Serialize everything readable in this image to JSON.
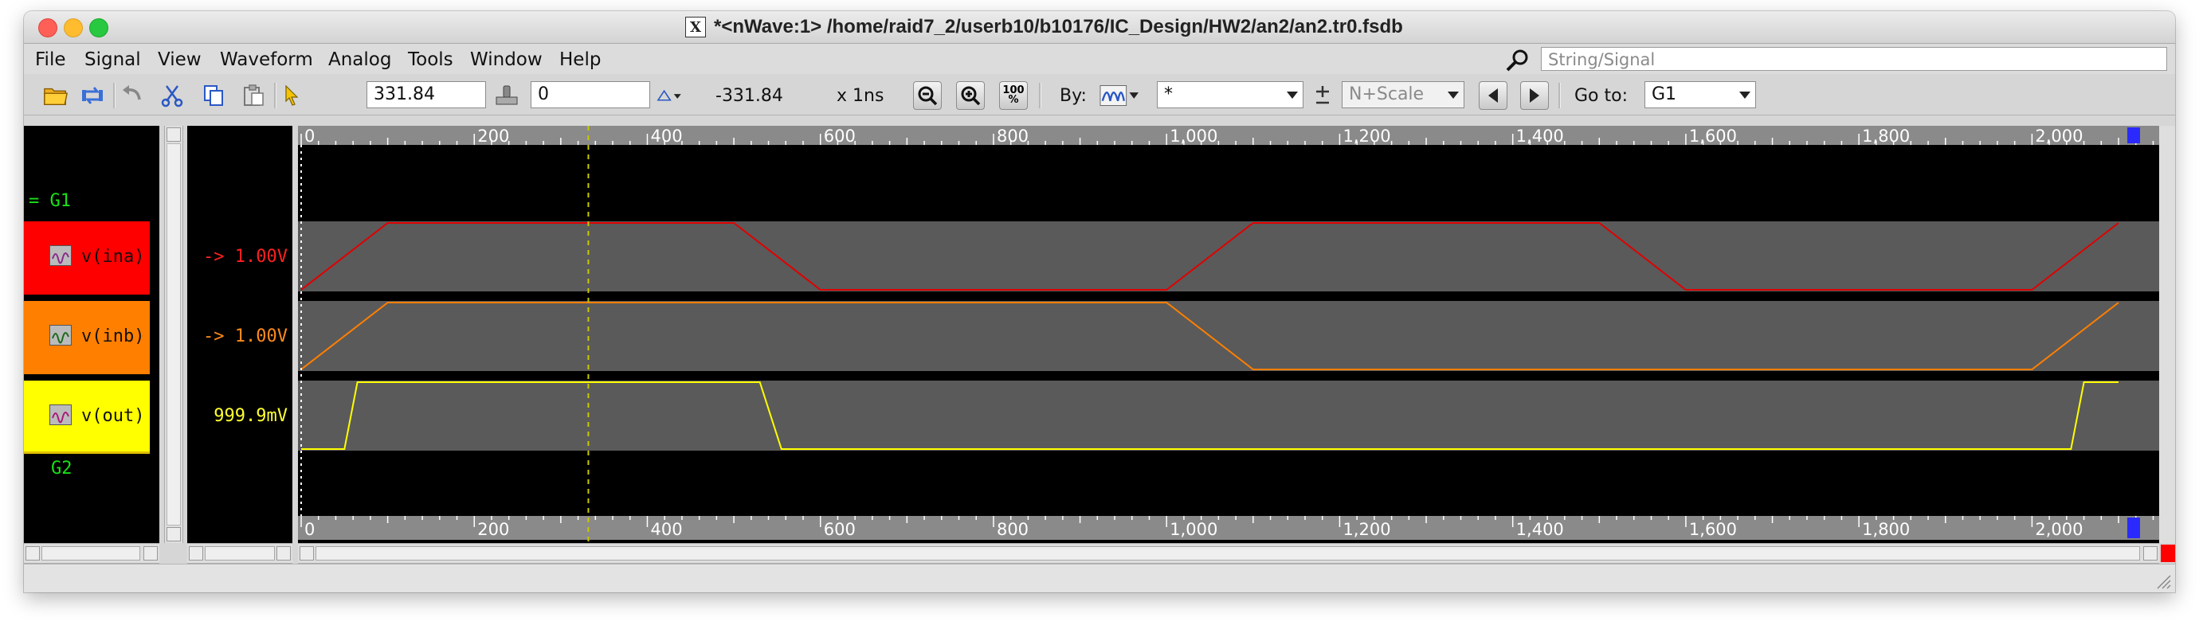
{
  "window": {
    "title": "*<nWave:1> /home/raid7_2/userb10/b10176/IC_Design/HW2/an2/an2.tr0.fsdb"
  },
  "menu": [
    {
      "label": "File"
    },
    {
      "label": "Signal"
    },
    {
      "label": "View"
    },
    {
      "label": "Waveform"
    },
    {
      "label": "Analog"
    },
    {
      "label": "Tools"
    },
    {
      "label": "Window"
    },
    {
      "label": "Help"
    }
  ],
  "search": {
    "placeholder": "String/Signal"
  },
  "toolbar": {
    "cursor_time": "331.84",
    "marker_time": "0",
    "delta": "-331.84",
    "unit": "x 1ns",
    "zoom_100": "100\n%",
    "by_label": "By:",
    "by_value": "*",
    "scale_value": "N+Scale",
    "goto_label": "Go to:",
    "goto_value": "G1"
  },
  "groups": [
    {
      "label": "= G1"
    },
    {
      "label": "G2"
    }
  ],
  "signals": [
    {
      "name": "v(ina)",
      "value": "-> 1.00V",
      "color": "#e00000",
      "name_bg": "#ff0000"
    },
    {
      "name": "v(inb)",
      "value": "-> 1.00V",
      "color": "#ff7f00",
      "name_bg": "#ff7f00"
    },
    {
      "name": "v(out)",
      "value": "999.9mV",
      "color": "#ffff00",
      "name_bg": "#ffff00"
    }
  ],
  "timeline": {
    "top_ticks": [
      "0",
      "200",
      "400",
      "600",
      "800",
      "1,000",
      "1,200",
      "1,400",
      "1,600",
      "1,800",
      "2,000"
    ],
    "bottom_ticks": [
      "0",
      "200",
      "400",
      "600",
      "800",
      "1,000",
      "1,200",
      "1,400",
      "1,600",
      "1,800",
      "2,000"
    ],
    "cursor_time_ns": 331.84,
    "marker_time_ns": 0
  },
  "waveforms": {
    "ina_ns": [
      [
        0,
        0
      ],
      [
        100,
        1
      ],
      [
        500,
        1
      ],
      [
        600,
        0
      ],
      [
        1000,
        0
      ],
      [
        1100,
        1
      ],
      [
        1500,
        1
      ],
      [
        1600,
        0
      ],
      [
        2000,
        0
      ],
      [
        2100,
        1
      ]
    ],
    "inb_ns": [
      [
        0,
        0
      ],
      [
        100,
        1
      ],
      [
        1000,
        1
      ],
      [
        1100,
        0
      ],
      [
        2000,
        0
      ],
      [
        2100,
        1
      ]
    ],
    "out_ns": [
      [
        0,
        0
      ],
      [
        50,
        0
      ],
      [
        65,
        1
      ],
      [
        530,
        1
      ],
      [
        555,
        0
      ],
      [
        2045,
        0
      ],
      [
        2060,
        1
      ],
      [
        2100,
        1
      ]
    ]
  },
  "colors": {
    "group": "#19e019",
    "cursor": "#c8c800",
    "marker": "#ffffff",
    "wave_bg": "#5a5a5a",
    "ruler_bg": "#8a8a8a"
  }
}
